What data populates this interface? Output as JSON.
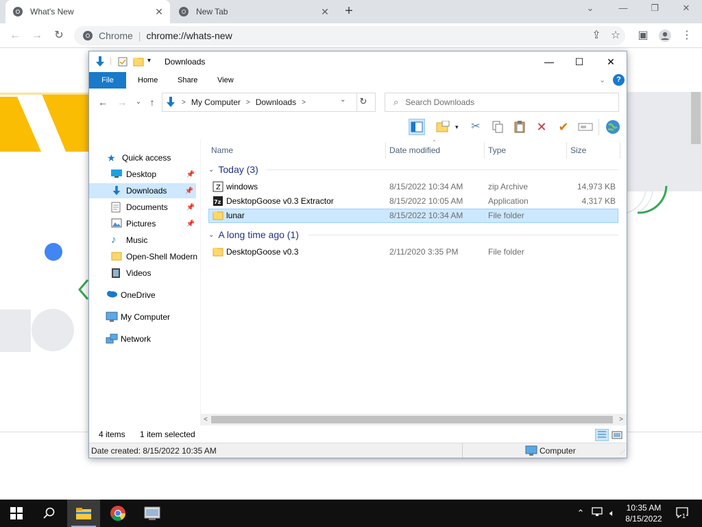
{
  "browser": {
    "tabs": [
      {
        "title": "What's New",
        "active": true
      },
      {
        "title": "New Tab",
        "active": false
      }
    ],
    "omnibox": {
      "site": "Chrome",
      "url": "chrome://whats-new"
    }
  },
  "explorer": {
    "title": "Downloads",
    "ribbon_tabs": [
      "File",
      "Home",
      "Share",
      "View"
    ],
    "breadcrumbs": [
      "My Computer",
      "Downloads"
    ],
    "search_placeholder": "Search Downloads",
    "nav": {
      "quick_access": "Quick access",
      "items": [
        "Desktop",
        "Downloads",
        "Documents",
        "Pictures",
        "Music",
        "Open-Shell Modern",
        "Videos"
      ],
      "onedrive": "OneDrive",
      "my_computer": "My Computer",
      "network": "Network"
    },
    "columns": [
      "Name",
      "Date modified",
      "Type",
      "Size"
    ],
    "groups": [
      {
        "label": "Today (3)",
        "files": [
          {
            "name": "windows",
            "date": "8/15/2022 10:34 AM",
            "type": "zip Archive",
            "size": "14,973 KB"
          },
          {
            "name": "DesktopGoose v0.3 Extractor",
            "date": "8/15/2022 10:05 AM",
            "type": "Application",
            "size": "4,317 KB"
          },
          {
            "name": "lunar",
            "date": "8/15/2022 10:34 AM",
            "type": "File folder",
            "size": ""
          }
        ]
      },
      {
        "label": "A long time ago (1)",
        "files": [
          {
            "name": "DesktopGoose v0.3",
            "date": "2/11/2020 3:35 PM",
            "type": "File folder",
            "size": ""
          }
        ]
      }
    ],
    "status": {
      "items": "4 items",
      "selected": "1 item selected"
    },
    "details": {
      "created": "Date created: 8/15/2022 10:35 AM",
      "location": "Computer"
    }
  },
  "taskbar": {
    "time": "10:35 AM",
    "date": "8/15/2022",
    "notifications": "1"
  },
  "colors": {
    "accent": "#1979ca",
    "selection": "#cce8ff",
    "taskbar": "#101010"
  }
}
